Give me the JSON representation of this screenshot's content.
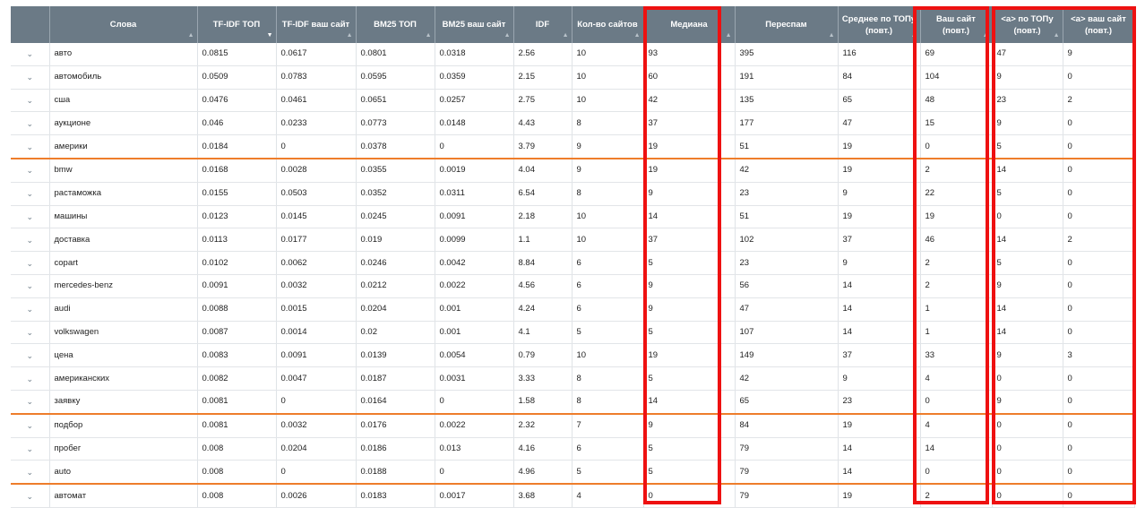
{
  "table": {
    "columns": [
      {
        "label": "",
        "sortable": false
      },
      {
        "label": "Слова",
        "sortable": true
      },
      {
        "label": "TF-IDF ТОП",
        "sortable": true,
        "active_sort": true
      },
      {
        "label": "TF-IDF ваш сайт",
        "sortable": true
      },
      {
        "label": "BM25 ТОП",
        "sortable": true
      },
      {
        "label": "BM25 ваш сайт",
        "sortable": true
      },
      {
        "label": "IDF",
        "sortable": true
      },
      {
        "label": "Кол-во сайтов",
        "sortable": true
      },
      {
        "label": "Медиана",
        "sortable": true
      },
      {
        "label": "Переспам",
        "sortable": true
      },
      {
        "label": "Среднее по ТОПу\n(повт.)",
        "sortable": true
      },
      {
        "label": "Ваш сайт (повт.)",
        "sortable": true
      },
      {
        "label": "<a> по ТОПу\n(повт.)",
        "sortable": true
      },
      {
        "label": "<a> ваш сайт\n(повт.)",
        "sortable": false
      }
    ],
    "expand_glyph": "⌄",
    "sort_glyph": "▲",
    "sort_active_glyph": "▼",
    "rows": [
      {
        "cells": [
          "авто",
          "0.0815",
          "0.0617",
          "0.0801",
          "0.0318",
          "2.56",
          "10",
          "93",
          "395",
          "116",
          "69",
          "47",
          "9"
        ]
      },
      {
        "cells": [
          "автомобиль",
          "0.0509",
          "0.0783",
          "0.0595",
          "0.0359",
          "2.15",
          "10",
          "60",
          "191",
          "84",
          "104",
          "9",
          "0"
        ]
      },
      {
        "cells": [
          "сша",
          "0.0476",
          "0.0461",
          "0.0651",
          "0.0257",
          "2.75",
          "10",
          "42",
          "135",
          "65",
          "48",
          "23",
          "2"
        ]
      },
      {
        "cells": [
          "аукционе",
          "0.046",
          "0.0233",
          "0.0773",
          "0.0148",
          "4.43",
          "8",
          "37",
          "177",
          "47",
          "15",
          "9",
          "0"
        ]
      },
      {
        "cells": [
          "америки",
          "0.0184",
          "0",
          "0.0378",
          "0",
          "3.79",
          "9",
          "19",
          "51",
          "19",
          "0",
          "5",
          "0"
        ],
        "separator": true
      },
      {
        "cells": [
          "bmw",
          "0.0168",
          "0.0028",
          "0.0355",
          "0.0019",
          "4.04",
          "9",
          "19",
          "42",
          "19",
          "2",
          "14",
          "0"
        ]
      },
      {
        "cells": [
          "растаможка",
          "0.0155",
          "0.0503",
          "0.0352",
          "0.0311",
          "6.54",
          "8",
          "9",
          "23",
          "9",
          "22",
          "5",
          "0"
        ]
      },
      {
        "cells": [
          "машины",
          "0.0123",
          "0.0145",
          "0.0245",
          "0.0091",
          "2.18",
          "10",
          "14",
          "51",
          "19",
          "19",
          "0",
          "0"
        ]
      },
      {
        "cells": [
          "доставка",
          "0.0113",
          "0.0177",
          "0.019",
          "0.0099",
          "1.1",
          "10",
          "37",
          "102",
          "37",
          "46",
          "14",
          "2"
        ]
      },
      {
        "cells": [
          "copart",
          "0.0102",
          "0.0062",
          "0.0246",
          "0.0042",
          "8.84",
          "6",
          "5",
          "23",
          "9",
          "2",
          "5",
          "0"
        ]
      },
      {
        "cells": [
          "mercedes-benz",
          "0.0091",
          "0.0032",
          "0.0212",
          "0.0022",
          "4.56",
          "6",
          "9",
          "56",
          "14",
          "2",
          "9",
          "0"
        ]
      },
      {
        "cells": [
          "audi",
          "0.0088",
          "0.0015",
          "0.0204",
          "0.001",
          "4.24",
          "6",
          "9",
          "47",
          "14",
          "1",
          "14",
          "0"
        ]
      },
      {
        "cells": [
          "volkswagen",
          "0.0087",
          "0.0014",
          "0.02",
          "0.001",
          "4.1",
          "5",
          "5",
          "107",
          "14",
          "1",
          "14",
          "0"
        ]
      },
      {
        "cells": [
          "цена",
          "0.0083",
          "0.0091",
          "0.0139",
          "0.0054",
          "0.79",
          "10",
          "19",
          "149",
          "37",
          "33",
          "9",
          "3"
        ]
      },
      {
        "cells": [
          "американских",
          "0.0082",
          "0.0047",
          "0.0187",
          "0.0031",
          "3.33",
          "8",
          "5",
          "42",
          "9",
          "4",
          "0",
          "0"
        ]
      },
      {
        "cells": [
          "заявку",
          "0.0081",
          "0",
          "0.0164",
          "0",
          "1.58",
          "8",
          "14",
          "65",
          "23",
          "0",
          "9",
          "0"
        ],
        "separator": true
      },
      {
        "cells": [
          "подбор",
          "0.0081",
          "0.0032",
          "0.0176",
          "0.0022",
          "2.32",
          "7",
          "9",
          "84",
          "19",
          "4",
          "0",
          "0"
        ]
      },
      {
        "cells": [
          "пробег",
          "0.008",
          "0.0204",
          "0.0186",
          "0.013",
          "4.16",
          "6",
          "5",
          "79",
          "14",
          "14",
          "0",
          "0"
        ]
      },
      {
        "cells": [
          "auto",
          "0.008",
          "0",
          "0.0188",
          "0",
          "4.96",
          "5",
          "5",
          "79",
          "14",
          "0",
          "0",
          "0"
        ],
        "separator": true
      },
      {
        "cells": [
          "автомат",
          "0.008",
          "0.0026",
          "0.0183",
          "0.0017",
          "3.68",
          "4",
          "0",
          "79",
          "19",
          "2",
          "0",
          "0"
        ]
      }
    ]
  },
  "colors": {
    "header_bg": "#6b7a86",
    "highlight": "#ee1111",
    "separator": "#ee7d2b"
  }
}
